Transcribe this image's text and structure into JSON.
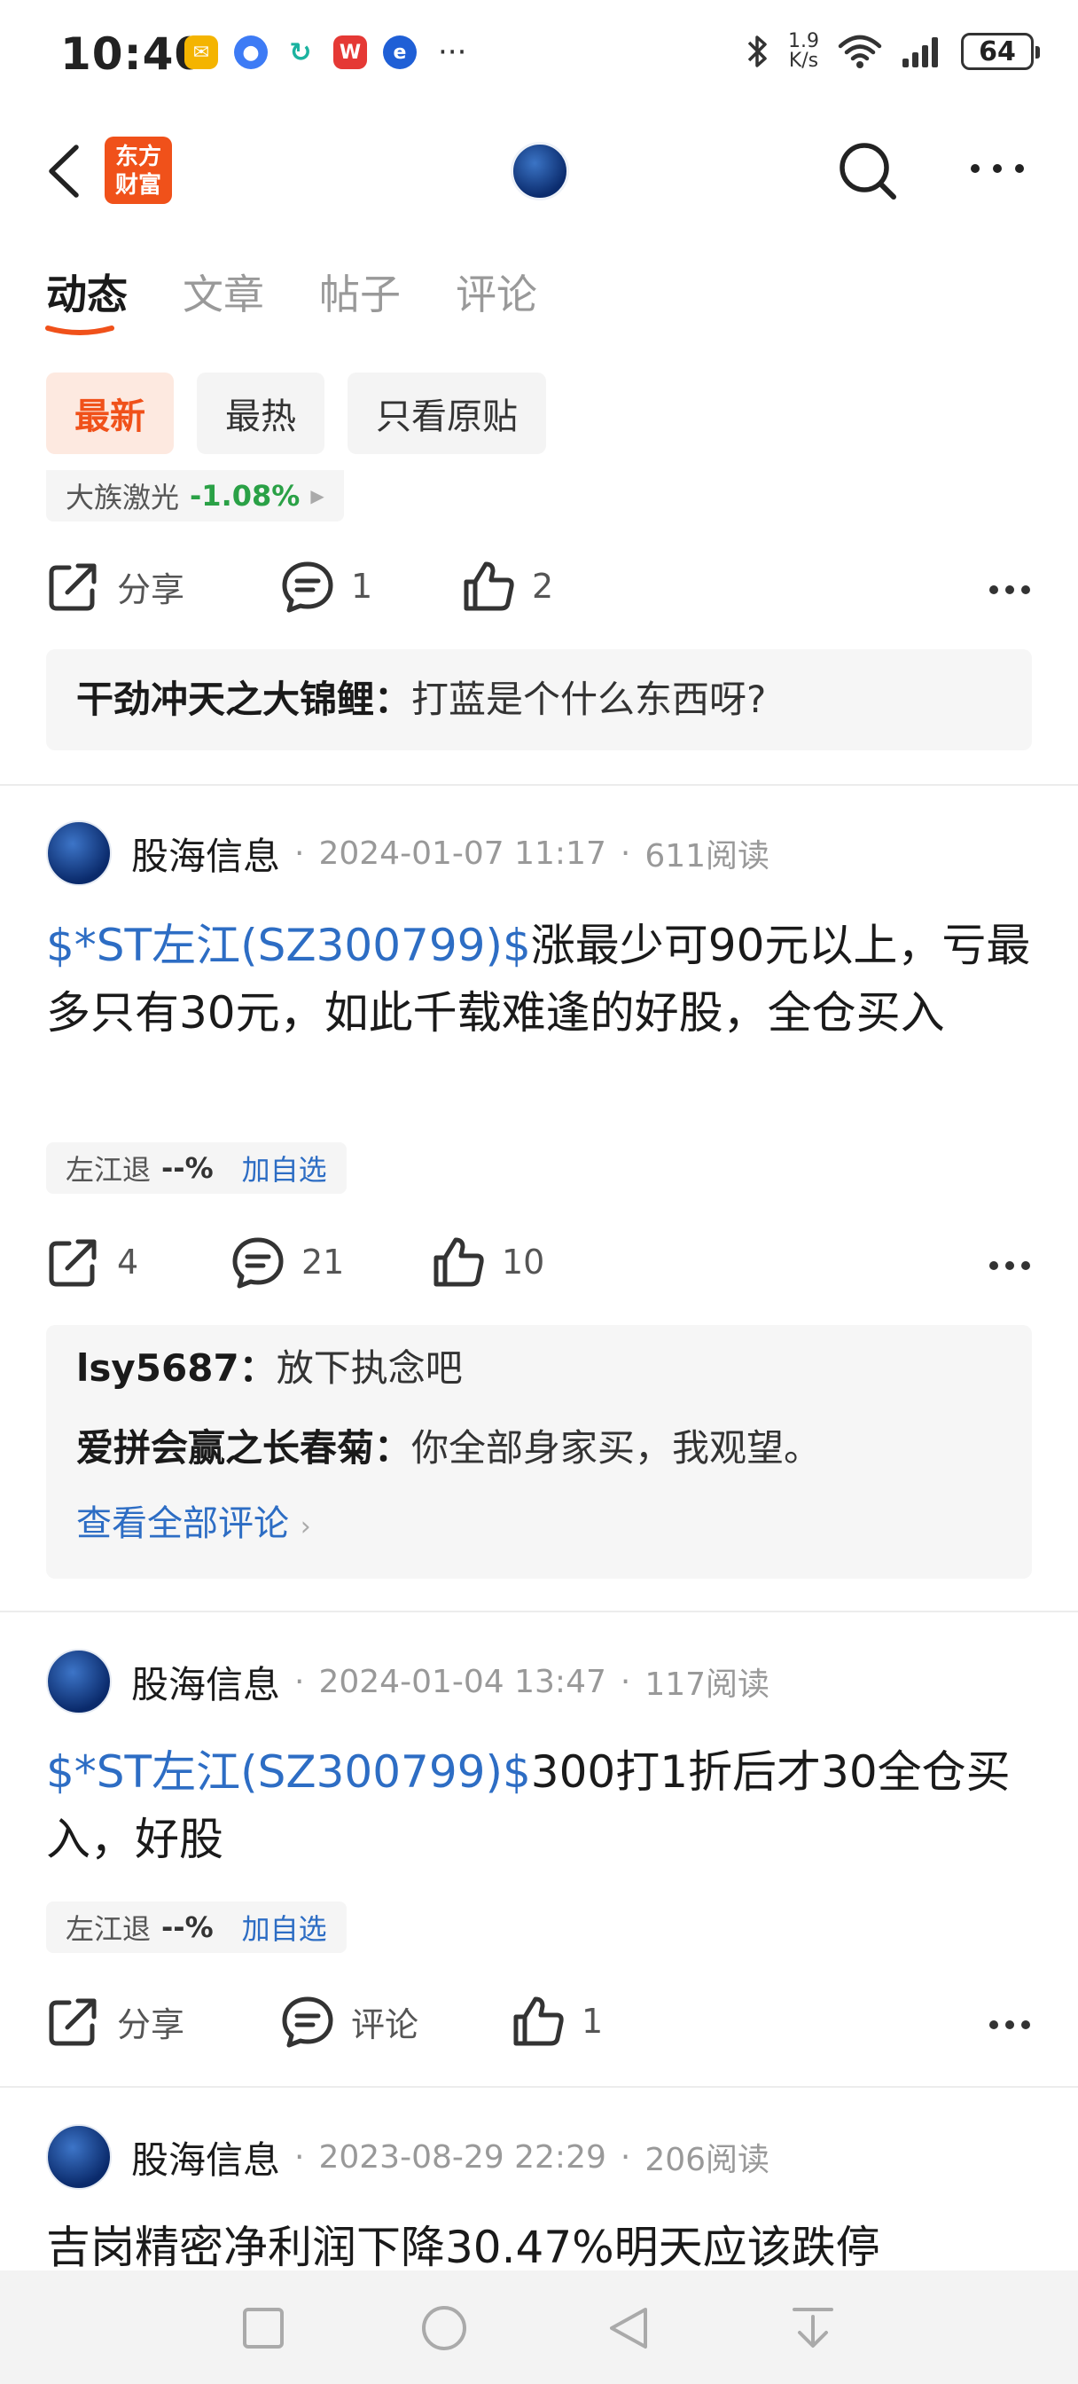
{
  "status_bar": {
    "time": "10:40",
    "speed_value": "1.9",
    "speed_unit": "K/s",
    "battery": "64",
    "more": "···"
  },
  "nav": {
    "logo_text_1": "东方",
    "logo_text_2": "财富"
  },
  "tabs": [
    {
      "label": "动态"
    },
    {
      "label": "文章"
    },
    {
      "label": "帖子"
    },
    {
      "label": "评论"
    }
  ],
  "filters": [
    {
      "label": "最新"
    },
    {
      "label": "最热"
    },
    {
      "label": "只看原贴"
    }
  ],
  "post0": {
    "stock_name": "大族激光",
    "stock_pct": "-1.08%",
    "share_label": "分享",
    "comments": "1",
    "likes": "2",
    "comment_box": [
      {
        "user": "干劲冲天之大锦鲤",
        "sep": "：",
        "text": "打蓝是个什么东西呀?"
      }
    ]
  },
  "post1": {
    "author": "股海信息",
    "dot": "·",
    "date": "2024-01-07 11:17",
    "reads": "611阅读",
    "stock_link": "$*ST左江(SZ300799)$",
    "text": "涨最少可90元以上，亏最多只有30元，如此千载难逢的好股，全仓买入",
    "stock_name": "左江退",
    "stock_pct": "--%",
    "add_label": "加自选",
    "shares": "4",
    "comments": "21",
    "likes": "10",
    "comment_box": [
      {
        "user": "lsy5687",
        "sep": "：",
        "text": "放下执念吧"
      },
      {
        "user": "爱拼会赢之长春菊",
        "sep": "：",
        "text": "你全部身家买，我观望。"
      }
    ],
    "view_all": "查看全部评论"
  },
  "post2": {
    "author": "股海信息",
    "dot": "·",
    "date": "2024-01-04 13:47",
    "reads": "117阅读",
    "stock_link": "$*ST左江(SZ300799)$",
    "text": "300打1折后才30全仓买入，好股",
    "stock_name": "左江退",
    "stock_pct": "--%",
    "add_label": "加自选",
    "share_label": "分享",
    "comment_label": "评论",
    "likes": "1"
  },
  "post3": {
    "author": "股海信息",
    "dot": "·",
    "date": "2023-08-29 22:29",
    "reads": "206阅读",
    "text": "吉岗精密净利润下降30.47%明天应该跌停"
  },
  "colors": {
    "accent": "#f0511a",
    "link": "#2d6dc4",
    "down_green": "#2aa146"
  }
}
